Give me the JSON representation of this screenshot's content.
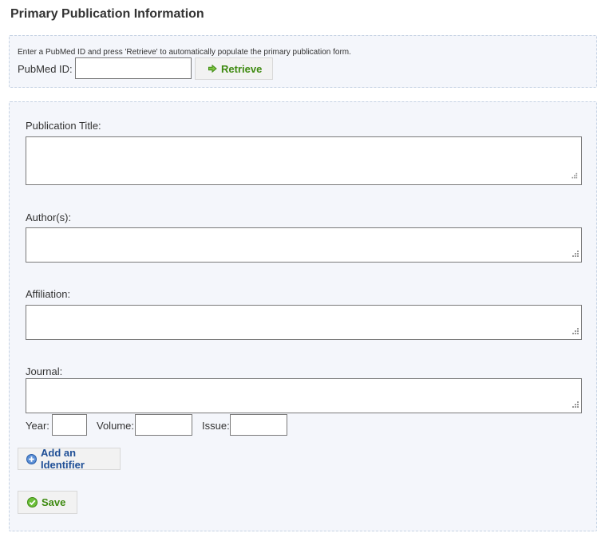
{
  "page": {
    "title": "Primary Publication Information"
  },
  "pubmed": {
    "instructions": "Enter a PubMed ID and press 'Retrieve' to automatically populate the primary publication form.",
    "label": "PubMed ID:",
    "value": "",
    "retrieve_label": "Retrieve"
  },
  "form": {
    "title_label": "Publication Title:",
    "title_value": "",
    "authors_label": "Author(s):",
    "authors_value": "",
    "affiliation_label": "Affiliation:",
    "affiliation_value": "",
    "journal_label": "Journal:",
    "journal_value": "",
    "year_label": "Year:",
    "year_value": "",
    "volume_label": "Volume:",
    "volume_value": "",
    "issue_label": "Issue:",
    "issue_value": "",
    "add_identifier_label": "Add an Identifier",
    "save_label": "Save"
  },
  "icons": {
    "retrieve": "arrow-right-icon",
    "add_identifier": "plus-circle-icon",
    "save": "check-circle-icon",
    "resize": "resize-grip-icon"
  },
  "colors": {
    "panel_bg": "#f4f6fb",
    "panel_border": "#c6d3e4",
    "green_action": "#3e8a10",
    "blue_action": "#1f4f96"
  }
}
